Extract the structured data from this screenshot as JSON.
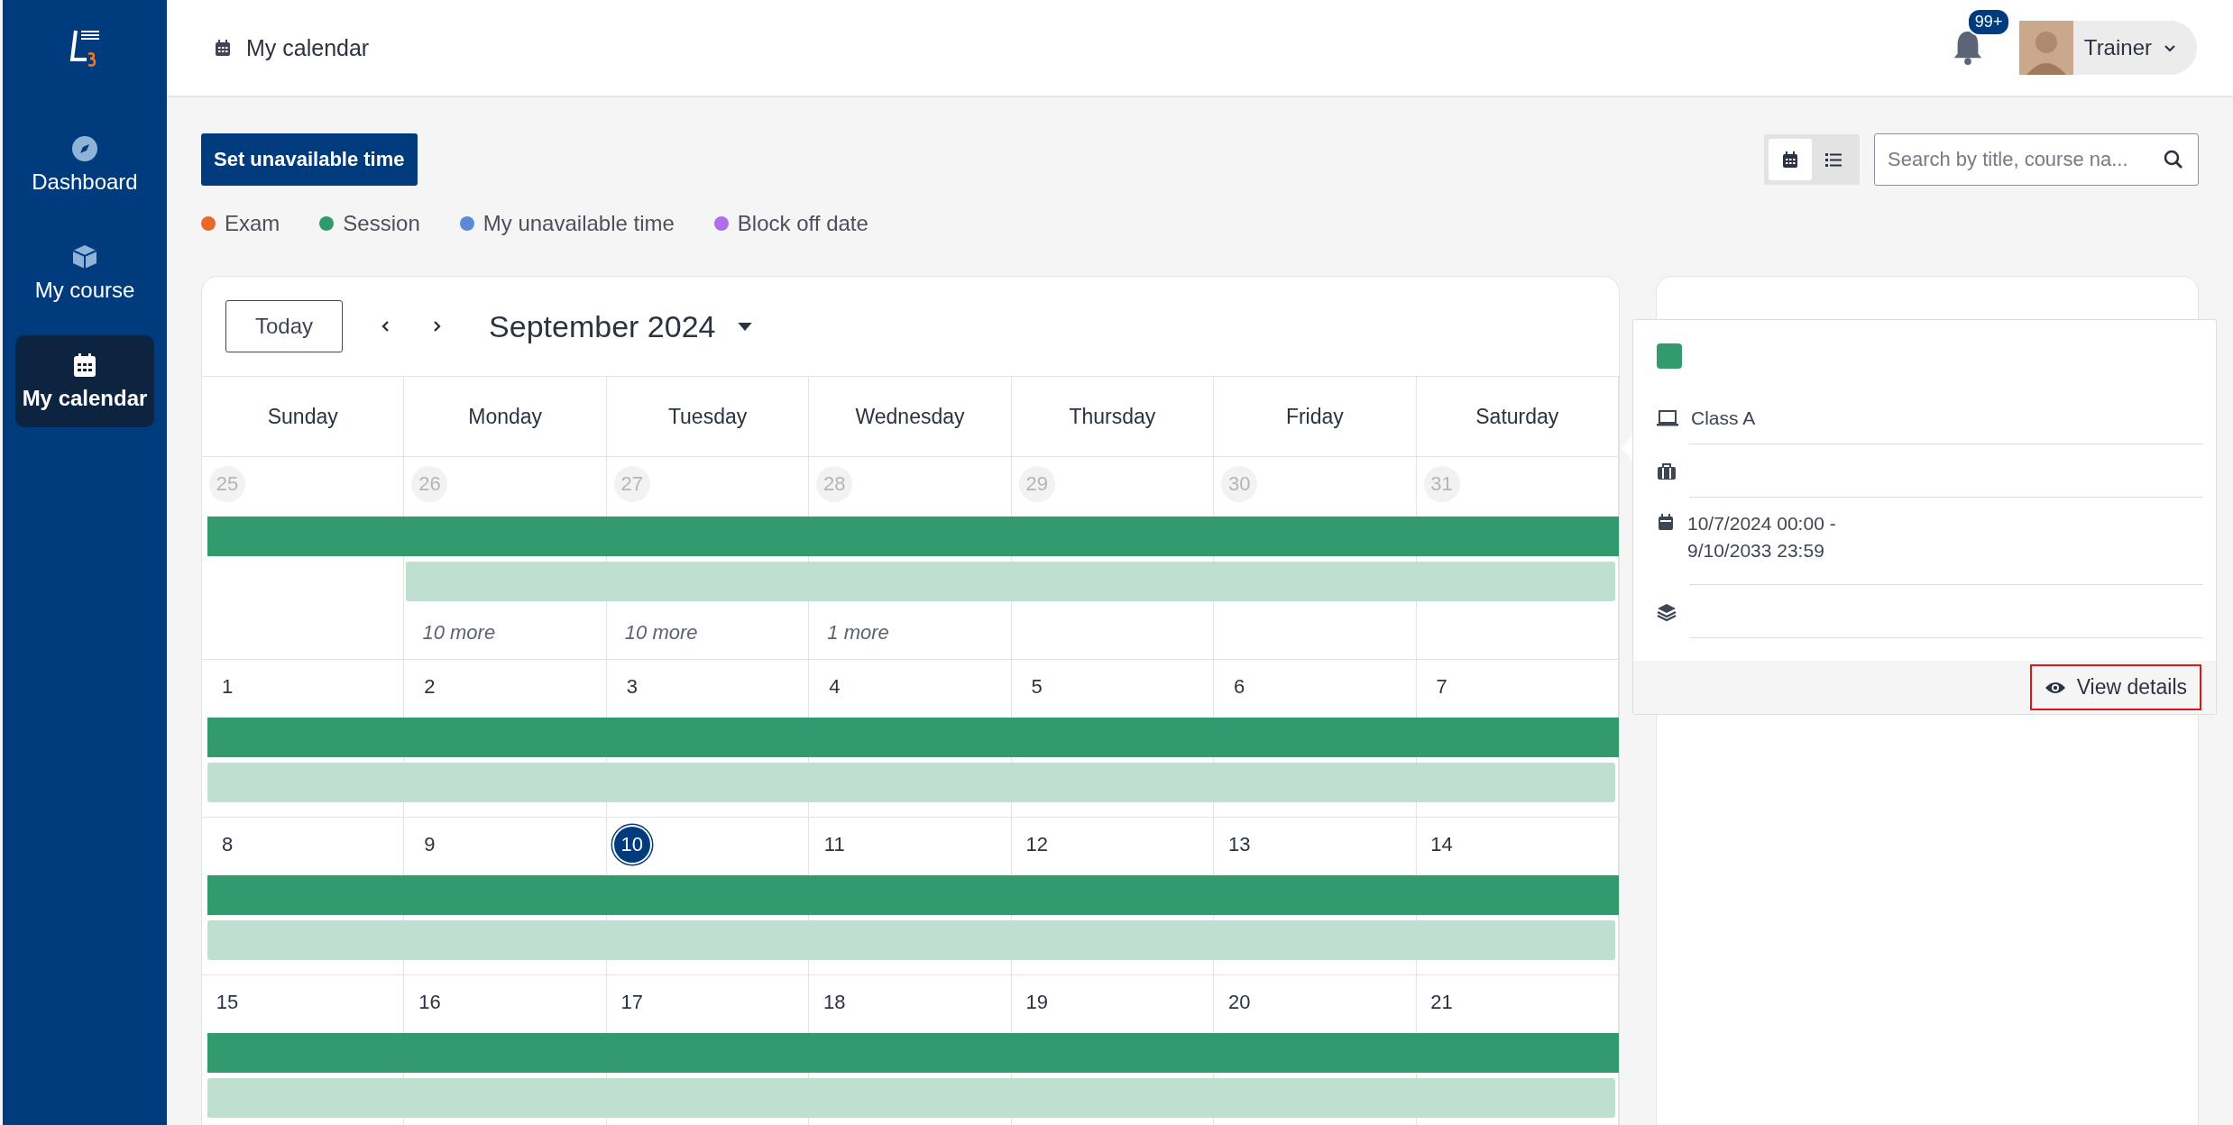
{
  "sidebar": {
    "items": [
      {
        "label": "Dashboard",
        "selected": false
      },
      {
        "label": "My course",
        "selected": false
      },
      {
        "label": "My calendar",
        "selected": true
      }
    ]
  },
  "header": {
    "title": "My calendar",
    "notification_count": "99+",
    "user": "Trainer"
  },
  "toolbar": {
    "button": "Set unavailable time",
    "views": [
      {
        "selected": true
      },
      {
        "selected": false
      }
    ],
    "search": {
      "placeholder": "Search by title, course na..."
    }
  },
  "legend": [
    {
      "label": "Exam",
      "color": "#e8692a"
    },
    {
      "label": "Session",
      "color": "#2e9b6c"
    },
    {
      "label": "My unavailable time",
      "color": "#5b8bd6"
    },
    {
      "label": "Block off date",
      "color": "#b06ee8"
    }
  ],
  "calendar": {
    "today_button": "Today",
    "month": "September 2024",
    "weekdays": [
      "Sunday",
      "Monday",
      "Tuesday",
      "Wednesday",
      "Thursday",
      "Friday",
      "Saturday"
    ],
    "weeks": [
      {
        "days": [
          {
            "date": "25",
            "muted": true,
            "today": false
          },
          {
            "date": "26",
            "muted": true,
            "today": false,
            "more": "10 more"
          },
          {
            "date": "27",
            "muted": true,
            "today": false,
            "more": "10 more"
          },
          {
            "date": "28",
            "muted": true,
            "today": false,
            "more": "1 more"
          },
          {
            "date": "29",
            "muted": true,
            "today": false
          },
          {
            "date": "30",
            "muted": true,
            "today": false
          },
          {
            "date": "31",
            "muted": true,
            "today": false
          }
        ]
      },
      {
        "days": [
          {
            "date": "1",
            "muted": false,
            "today": false
          },
          {
            "date": "2",
            "muted": false,
            "today": false
          },
          {
            "date": "3",
            "muted": false,
            "today": false
          },
          {
            "date": "4",
            "muted": false,
            "today": false
          },
          {
            "date": "5",
            "muted": false,
            "today": false
          },
          {
            "date": "6",
            "muted": false,
            "today": false
          },
          {
            "date": "7",
            "muted": false,
            "today": false
          }
        ]
      },
      {
        "days": [
          {
            "date": "8",
            "muted": false,
            "today": false
          },
          {
            "date": "9",
            "muted": false,
            "today": false
          },
          {
            "date": "10",
            "muted": false,
            "today": true
          },
          {
            "date": "11",
            "muted": false,
            "today": false
          },
          {
            "date": "12",
            "muted": false,
            "today": false
          },
          {
            "date": "13",
            "muted": false,
            "today": false
          },
          {
            "date": "14",
            "muted": false,
            "today": false
          }
        ]
      },
      {
        "days": [
          {
            "date": "15",
            "muted": false,
            "today": false
          },
          {
            "date": "16",
            "muted": false,
            "today": false
          },
          {
            "date": "17",
            "muted": false,
            "today": false
          },
          {
            "date": "18",
            "muted": false,
            "today": false
          },
          {
            "date": "19",
            "muted": false,
            "today": false
          },
          {
            "date": "20",
            "muted": false,
            "today": false
          },
          {
            "date": "21",
            "muted": false,
            "today": false
          }
        ]
      }
    ]
  },
  "popup": {
    "color": "#339a6e",
    "class": "Class A",
    "time": [
      "10/7/2024 00:00 -",
      "9/10/2033 23:59"
    ],
    "action": "View details"
  }
}
